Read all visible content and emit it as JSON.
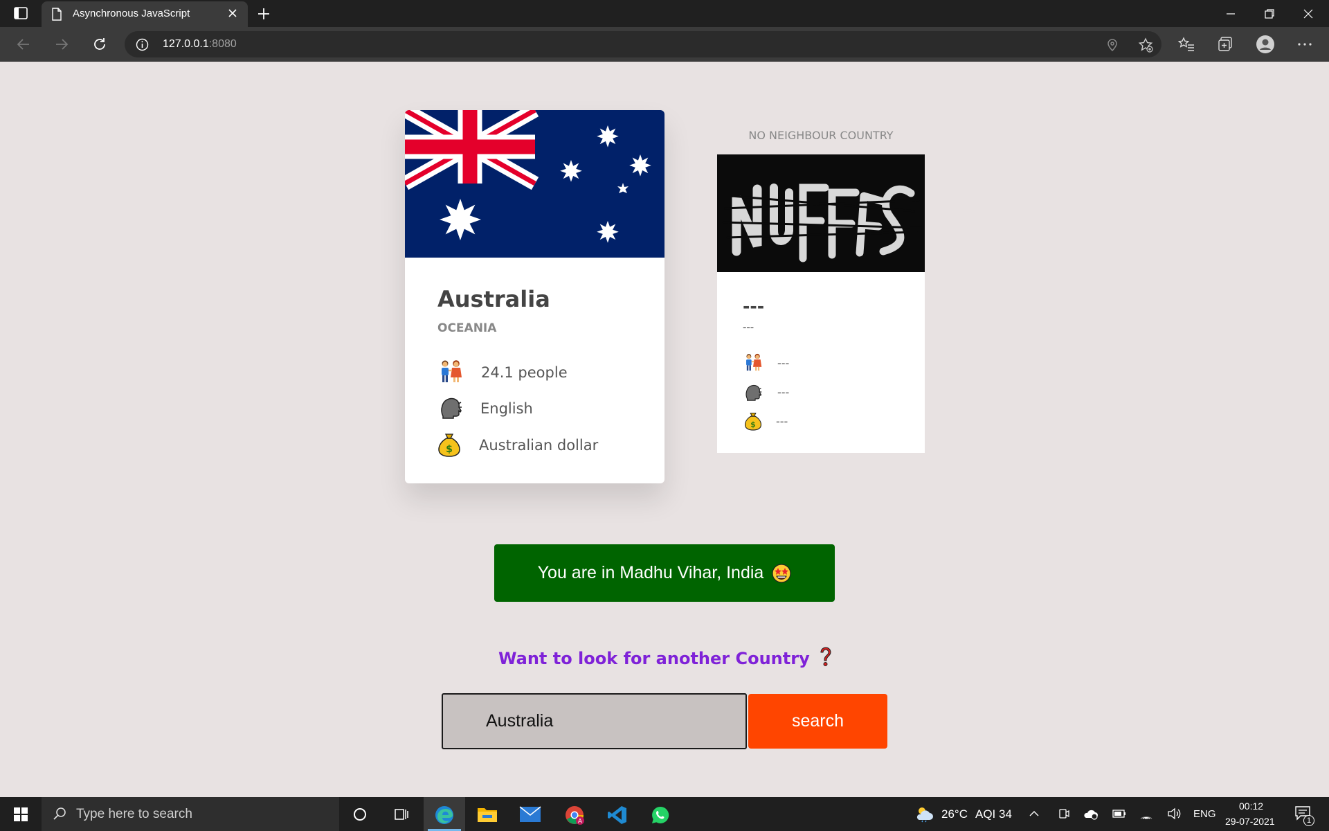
{
  "browser": {
    "tab_title": "Asynchronous JavaScript",
    "url_host": "127.0.0.1",
    "url_port": ":8080"
  },
  "main_country": {
    "name": "Australia",
    "region": "OCEANIA",
    "population": "24.1 people",
    "language": "English",
    "currency": "Australian dollar",
    "flag_colors": [
      "#012169",
      "#ffffff",
      "#e4002b"
    ]
  },
  "neighbour": {
    "label": "NO NEIGHBOUR COUNTRY",
    "name": "---",
    "region": "---",
    "population": "---",
    "language": "---",
    "currency": "---"
  },
  "location_banner": {
    "text": "You are in Madhu Vihar, India",
    "color": "#006400"
  },
  "search": {
    "prompt": "Want to look for another Country",
    "value": "Australia",
    "button_label": "search",
    "button_color": "#ff4500",
    "prompt_color": "#7f22d8"
  },
  "taskbar": {
    "search_placeholder": "Type here to search",
    "weather": "26°C",
    "aqi": "AQI 34",
    "language": "ENG",
    "time": "00:12",
    "date": "29-07-2021",
    "notifications": "1"
  },
  "icons": {
    "population": "people-holding-hands-icon",
    "language": "speaking-head-icon",
    "currency": "money-bag-icon",
    "banner_emoji": "star-struck-face-icon",
    "prompt_emoji": "red-question-mark-icon"
  }
}
